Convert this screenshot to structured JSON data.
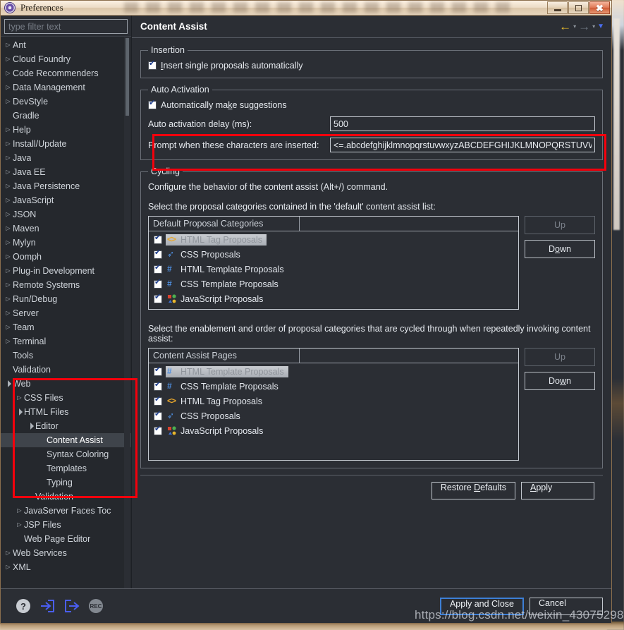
{
  "window": {
    "title": "Preferences",
    "icon": "preferences-icon",
    "buttons": {
      "minimize": "–",
      "maximize": "□",
      "close": "✕"
    }
  },
  "sidebar": {
    "filter": {
      "placeholder": "type filter text",
      "value": ""
    },
    "items": [
      {
        "label": "Ant",
        "indent": 0,
        "twisty": "collapsed",
        "selected": false
      },
      {
        "label": "Cloud Foundry",
        "indent": 0,
        "twisty": "collapsed",
        "selected": false
      },
      {
        "label": "Code Recommenders",
        "indent": 0,
        "twisty": "collapsed",
        "selected": false
      },
      {
        "label": "Data Management",
        "indent": 0,
        "twisty": "collapsed",
        "selected": false
      },
      {
        "label": "DevStyle",
        "indent": 0,
        "twisty": "collapsed",
        "selected": false
      },
      {
        "label": "Gradle",
        "indent": 0,
        "twisty": "none",
        "selected": false
      },
      {
        "label": "Help",
        "indent": 0,
        "twisty": "collapsed",
        "selected": false
      },
      {
        "label": "Install/Update",
        "indent": 0,
        "twisty": "collapsed",
        "selected": false
      },
      {
        "label": "Java",
        "indent": 0,
        "twisty": "collapsed",
        "selected": false
      },
      {
        "label": "Java EE",
        "indent": 0,
        "twisty": "collapsed",
        "selected": false
      },
      {
        "label": "Java Persistence",
        "indent": 0,
        "twisty": "collapsed",
        "selected": false
      },
      {
        "label": "JavaScript",
        "indent": 0,
        "twisty": "collapsed",
        "selected": false
      },
      {
        "label": "JSON",
        "indent": 0,
        "twisty": "collapsed",
        "selected": false
      },
      {
        "label": "Maven",
        "indent": 0,
        "twisty": "collapsed",
        "selected": false
      },
      {
        "label": "Mylyn",
        "indent": 0,
        "twisty": "collapsed",
        "selected": false
      },
      {
        "label": "Oomph",
        "indent": 0,
        "twisty": "collapsed",
        "selected": false
      },
      {
        "label": "Plug-in Development",
        "indent": 0,
        "twisty": "collapsed",
        "selected": false
      },
      {
        "label": "Remote Systems",
        "indent": 0,
        "twisty": "collapsed",
        "selected": false
      },
      {
        "label": "Run/Debug",
        "indent": 0,
        "twisty": "collapsed",
        "selected": false
      },
      {
        "label": "Server",
        "indent": 0,
        "twisty": "collapsed",
        "selected": false
      },
      {
        "label": "Team",
        "indent": 0,
        "twisty": "collapsed",
        "selected": false
      },
      {
        "label": "Terminal",
        "indent": 0,
        "twisty": "collapsed",
        "selected": false
      },
      {
        "label": "Tools",
        "indent": 0,
        "twisty": "none",
        "selected": false
      },
      {
        "label": "Validation",
        "indent": 0,
        "twisty": "none",
        "selected": false
      },
      {
        "label": "Web",
        "indent": 0,
        "twisty": "expanded",
        "selected": false
      },
      {
        "label": "CSS Files",
        "indent": 1,
        "twisty": "collapsed",
        "selected": false
      },
      {
        "label": "HTML Files",
        "indent": 1,
        "twisty": "expanded",
        "selected": false
      },
      {
        "label": "Editor",
        "indent": 2,
        "twisty": "expanded",
        "selected": false
      },
      {
        "label": "Content Assist",
        "indent": 3,
        "twisty": "none",
        "selected": true
      },
      {
        "label": "Syntax Coloring",
        "indent": 3,
        "twisty": "none",
        "selected": false
      },
      {
        "label": "Templates",
        "indent": 3,
        "twisty": "none",
        "selected": false
      },
      {
        "label": "Typing",
        "indent": 3,
        "twisty": "none",
        "selected": false
      },
      {
        "label": "Validation",
        "indent": 2,
        "twisty": "none",
        "selected": false
      },
      {
        "label": "JavaServer Faces Toc",
        "indent": 1,
        "twisty": "collapsed",
        "selected": false
      },
      {
        "label": "JSP Files",
        "indent": 1,
        "twisty": "collapsed",
        "selected": false
      },
      {
        "label": "Web Page Editor",
        "indent": 1,
        "twisty": "none",
        "selected": false
      },
      {
        "label": "Web Services",
        "indent": 0,
        "twisty": "collapsed",
        "selected": false
      },
      {
        "label": "XML",
        "indent": 0,
        "twisty": "collapsed",
        "selected": false
      }
    ]
  },
  "page": {
    "title": "Content Assist",
    "nav": {
      "back": "←",
      "forward": "→",
      "caret": "▾",
      "menu_caret": "▼"
    },
    "insertion": {
      "legend": "Insertion",
      "insert_single_label": "Insert single proposals automatically",
      "insert_single_checked": true
    },
    "auto_activation": {
      "legend": "Auto Activation",
      "auto_suggest_label": "Automatically make suggestions",
      "auto_suggest_checked": true,
      "delay_label": "Auto activation delay (ms):",
      "delay_value": "500",
      "prompt_label": "Prompt when these characters are inserted:",
      "prompt_value": "<=.abcdefghijklmnopqrstuvwxyzABCDEFGHIJKLMNOPQRSTUVW"
    },
    "cycling": {
      "legend": "Cycling",
      "description": "Configure the behavior of the content assist (Alt+/) command.",
      "default_list_label": "Select the proposal categories contained in the 'default' content assist list:",
      "default_list": {
        "header_col1": "Default Proposal Categories",
        "header_col2": "",
        "rows": [
          {
            "label": "HTML Tag Proposals",
            "checked": true,
            "icon": "html-tag-icon",
            "selected": true
          },
          {
            "label": "CSS Proposals",
            "checked": true,
            "icon": "css-icon",
            "selected": false
          },
          {
            "label": "HTML Template Proposals",
            "checked": true,
            "icon": "template-icon",
            "selected": false
          },
          {
            "label": "CSS Template Proposals",
            "checked": true,
            "icon": "template-icon",
            "selected": false
          },
          {
            "label": "JavaScript Proposals",
            "checked": true,
            "icon": "javascript-icon",
            "selected": false
          }
        ],
        "up_label": "Up",
        "down_label": "Down"
      },
      "cycle_list_label": "Select the enablement and order of proposal categories that are cycled through when repeatedly invoking content assist:",
      "cycle_list": {
        "header_col1": "Content Assist Pages",
        "header_col2": "",
        "rows": [
          {
            "label": "HTML Template Proposals",
            "checked": true,
            "icon": "template-icon",
            "selected": true
          },
          {
            "label": "CSS Template Proposals",
            "checked": true,
            "icon": "template-icon",
            "selected": false
          },
          {
            "label": "HTML Tag Proposals",
            "checked": true,
            "icon": "html-tag-icon",
            "selected": false
          },
          {
            "label": "CSS Proposals",
            "checked": true,
            "icon": "css-icon",
            "selected": false
          },
          {
            "label": "JavaScript Proposals",
            "checked": true,
            "icon": "javascript-icon",
            "selected": false
          }
        ],
        "up_label": "Up",
        "down_label": "Down"
      }
    },
    "restore_defaults_label": "Restore Defaults",
    "apply_label": "Apply"
  },
  "footer": {
    "icons": [
      {
        "name": "help-icon",
        "glyph": "?"
      },
      {
        "name": "import-icon",
        "glyph": "import"
      },
      {
        "name": "export-icon",
        "glyph": "export"
      },
      {
        "name": "record-icon",
        "glyph": "REC"
      }
    ],
    "apply_and_close_label": "Apply and Close",
    "cancel_label": "Cancel"
  },
  "watermark": "https://blog.csdn.net/weixin_43075298",
  "colors": {
    "accent_blue": "#3d7fd6",
    "annotation_red": "#f4000c",
    "back_arrow_yellow": "#f0c22a",
    "panel_bg": "#2b2e34",
    "selection": "#3f444b"
  }
}
